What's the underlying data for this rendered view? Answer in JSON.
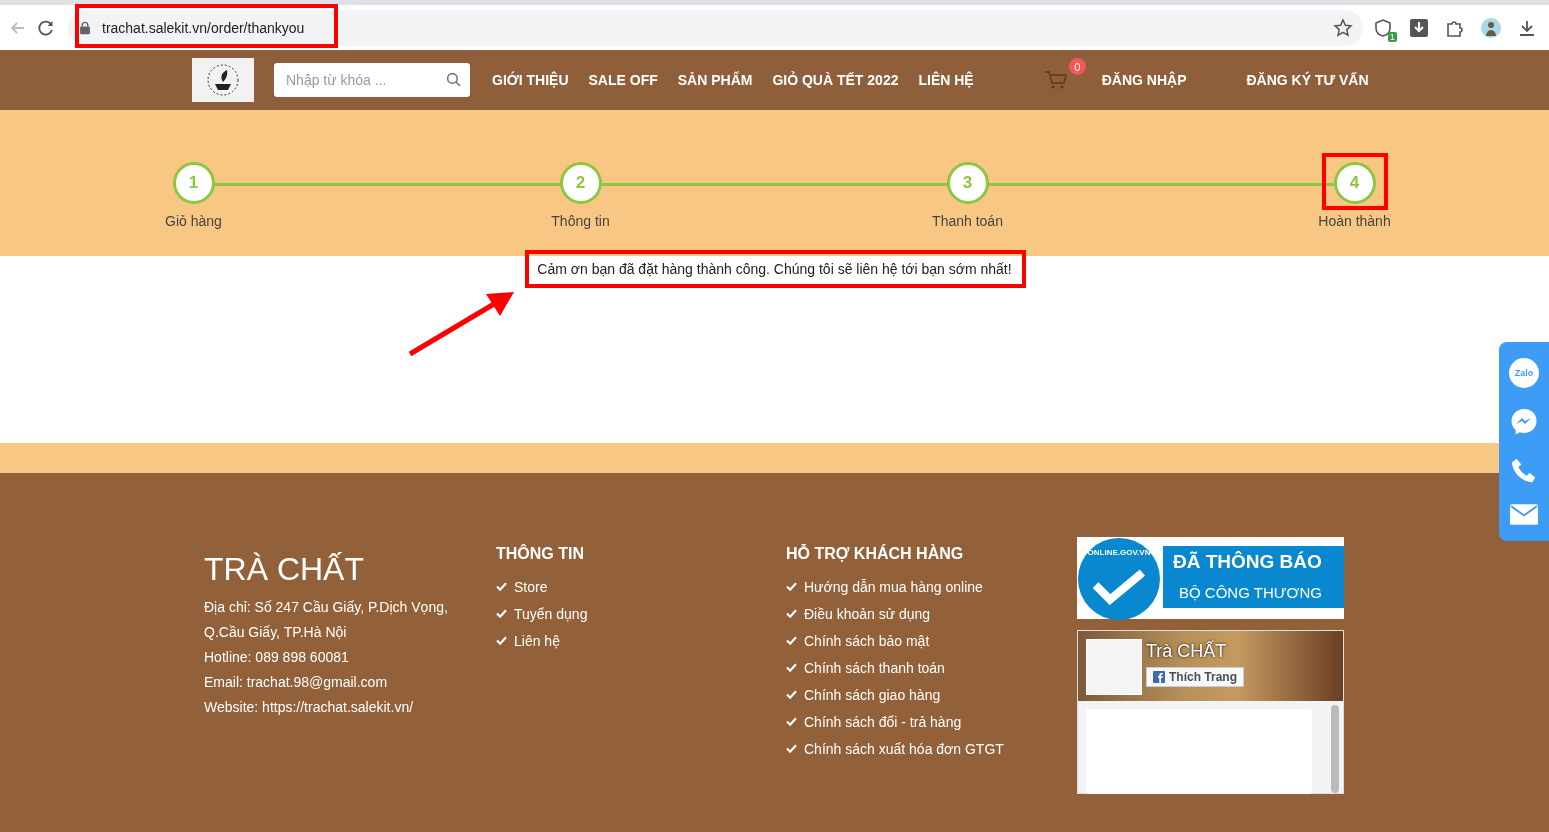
{
  "browser": {
    "url": "trachat.salekit.vn/order/thankyou",
    "extension_badge": "1"
  },
  "nav": {
    "search": {
      "placeholder": "Nhập từ khóa ..."
    },
    "menu": [
      "GIỚI THIỆU",
      "SALE OFF",
      "SẢN PHẨM",
      "GIỎ QUÀ TẾT 2022",
      "LIÊN HỆ"
    ],
    "cart_count": "0",
    "login": "ĐĂNG NHẬP",
    "register": "ĐĂNG KÝ TƯ VẤN"
  },
  "steps": [
    {
      "number": "1",
      "label": "Giỏ hàng"
    },
    {
      "number": "2",
      "label": "Thông tin"
    },
    {
      "number": "3",
      "label": "Thanh toán"
    },
    {
      "number": "4",
      "label": "Hoàn thành"
    }
  ],
  "message": "Cảm ơn bạn đã đặt hàng thành công. Chúng tôi sẽ liên hệ tới bạn sớm nhất!",
  "footer": {
    "brand": "TRÀ CHẤT",
    "contact": [
      "Địa chỉ:  Số 247 Cầu Giấy, P.Dịch Vọng, Q.Cầu Giấy, TP.Hà Nội",
      "Hotline:  089 898 60081",
      "Email: trachat.98@gmail.com",
      "Website: https://trachat.salekit.vn/"
    ],
    "columns": [
      {
        "title": "THÔNG TIN",
        "links": [
          "Store",
          "Tuyển dụng",
          "Liên hệ"
        ]
      },
      {
        "title": "HỖ TRỢ KHÁCH HÀNG",
        "links": [
          "Hướng dẫn mua hàng online",
          "Điều khoản sử dụng",
          "Chính sách bảo mật",
          "Chính sách thanh toán",
          "Chính sách giao hàng",
          "Chính sách đổi - trả hàng",
          "Chính sách xuất hóa đơn GTGT"
        ]
      }
    ],
    "badge": {
      "seal": "ONLINE.GOV.VN",
      "line_1": "ĐÃ THÔNG BÁO",
      "line_2": "BỘ CÔNG THƯƠNG"
    },
    "facebook": {
      "page_name": "Trà CHẤT",
      "like_button": "Thích Trang"
    }
  },
  "side_contacts": {
    "zalo": "Zalo"
  }
}
